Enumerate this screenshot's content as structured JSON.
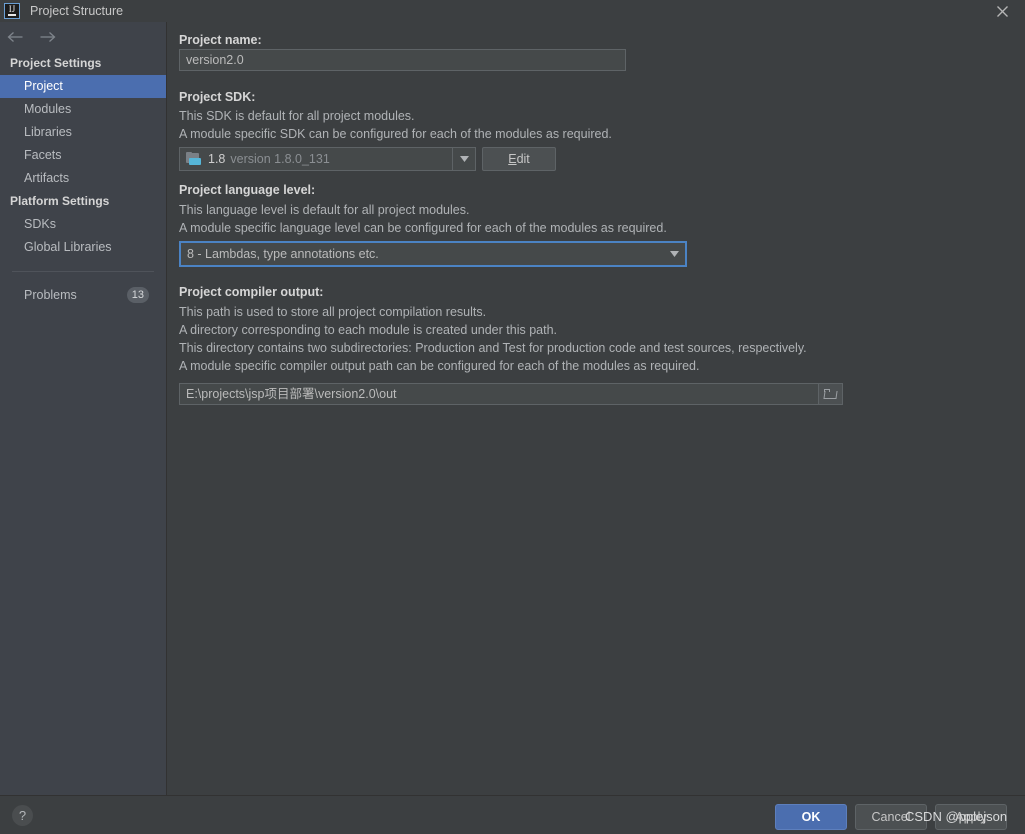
{
  "window": {
    "title": "Project Structure",
    "app_icon": "intellij-idea-icon",
    "close_label": "×"
  },
  "nav": {
    "back_label": "←",
    "forward_label": "→"
  },
  "sidebar": {
    "groups": [
      {
        "title": "Project Settings",
        "items": [
          {
            "label": "Project",
            "selected": true
          },
          {
            "label": "Modules",
            "selected": false
          },
          {
            "label": "Libraries",
            "selected": false
          },
          {
            "label": "Facets",
            "selected": false
          },
          {
            "label": "Artifacts",
            "selected": false
          }
        ]
      },
      {
        "title": "Platform Settings",
        "items": [
          {
            "label": "SDKs",
            "selected": false
          },
          {
            "label": "Global Libraries",
            "selected": false
          }
        ]
      }
    ],
    "problems": {
      "label": "Problems",
      "count": "13"
    }
  },
  "main": {
    "project_name": {
      "label": "Project name:",
      "value": "version2.0"
    },
    "project_sdk": {
      "label": "Project SDK:",
      "desc_line1": "This SDK is default for all project modules.",
      "desc_line2": "A module specific SDK can be configured for each of the modules as required.",
      "selected_name": "1.8",
      "selected_version": "version 1.8.0_131",
      "edit_button": {
        "mnemonic": "E",
        "rest": "dit"
      }
    },
    "language_level": {
      "label": "Project language level:",
      "desc_line1": "This language level is default for all project modules.",
      "desc_line2": "A module specific language level can be configured for each of the modules as required.",
      "value": "8 - Lambdas, type annotations etc."
    },
    "compiler_output": {
      "label": "Project compiler output:",
      "desc_line1": "This path is used to store all project compilation results.",
      "desc_line2": "A directory corresponding to each module is created under this path.",
      "desc_line3": "This directory contains two subdirectories: Production and Test for production code and test sources, respectively.",
      "desc_line4": "A module specific compiler output path can be configured for each of the modules as required.",
      "value": "E:\\projects\\jsp项目部署\\version2.0\\out"
    }
  },
  "footer": {
    "help_label": "?",
    "ok_label": "OK",
    "cancel_label": "Cancel",
    "apply_label": "Apply"
  },
  "watermark": {
    "text": "CSDN @pplejson"
  },
  "colors": {
    "accent_blue": "#4b6eaf",
    "focus_border": "#4b83c4",
    "panel_bg": "#3c3f41",
    "sidebar_bg": "#3f434a",
    "field_bg": "#45494a"
  }
}
